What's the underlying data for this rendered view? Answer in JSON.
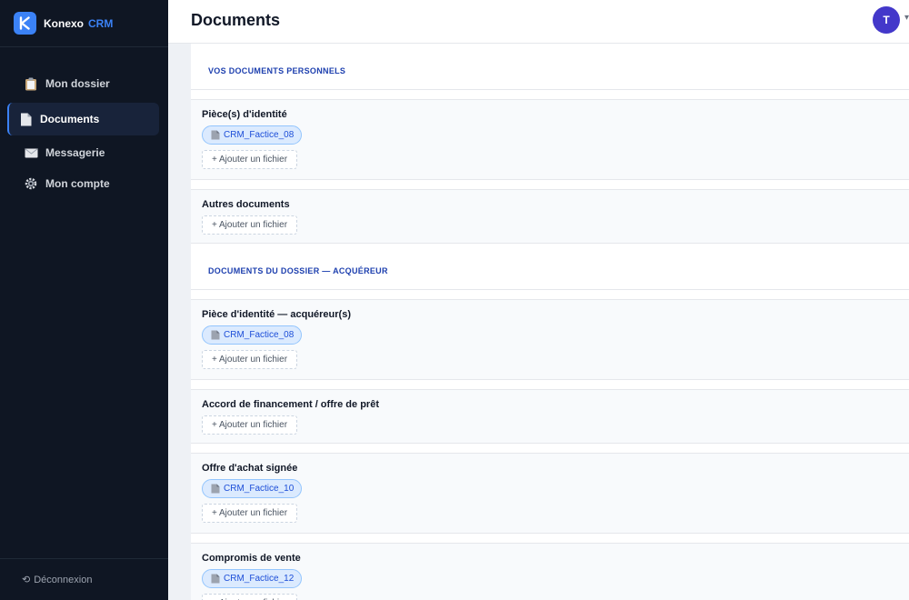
{
  "brand": {
    "name": "Konexo",
    "accent": "CRM",
    "logo_letter": "K"
  },
  "sidebar": {
    "items": [
      {
        "label": "Mon dossier",
        "icon": "clipboard-icon"
      },
      {
        "label": "Documents",
        "icon": "document-icon",
        "active": true
      },
      {
        "label": "Messagerie",
        "icon": "envelope-icon"
      },
      {
        "label": "Mon compte",
        "icon": "gear-icon"
      }
    ],
    "logout_label": "Déconnexion"
  },
  "header": {
    "title": "Documents",
    "avatar_initial": "T"
  },
  "sections": [
    {
      "title": "VOS DOCUMENTS PERSONNELS",
      "cards": [
        {
          "title": "Pièce(s) d'identité",
          "files": [
            "CRM_Factice_08"
          ]
        },
        {
          "title": "Autres documents",
          "files": []
        }
      ]
    },
    {
      "title": "DOCUMENTS DU DOSSIER — ACQUÉREUR",
      "cards": [
        {
          "title": "Pièce d'identité — acquéreur(s)",
          "files": [
            "CRM_Factice_08"
          ]
        },
        {
          "title": "Accord de financement / offre de prêt",
          "files": []
        },
        {
          "title": "Offre d'achat signée",
          "files": [
            "CRM_Factice_10"
          ]
        },
        {
          "title": "Compromis de vente",
          "files": [
            "CRM_Factice_12"
          ]
        }
      ]
    }
  ],
  "add_file_label": "+ Ajouter un fichier",
  "colors": {
    "sidebar_bg": "#0f1623",
    "accent": "#3b82f6",
    "section_title": "#1e40af",
    "chip_bg": "#dbeafe",
    "avatar": "#4338ca"
  }
}
